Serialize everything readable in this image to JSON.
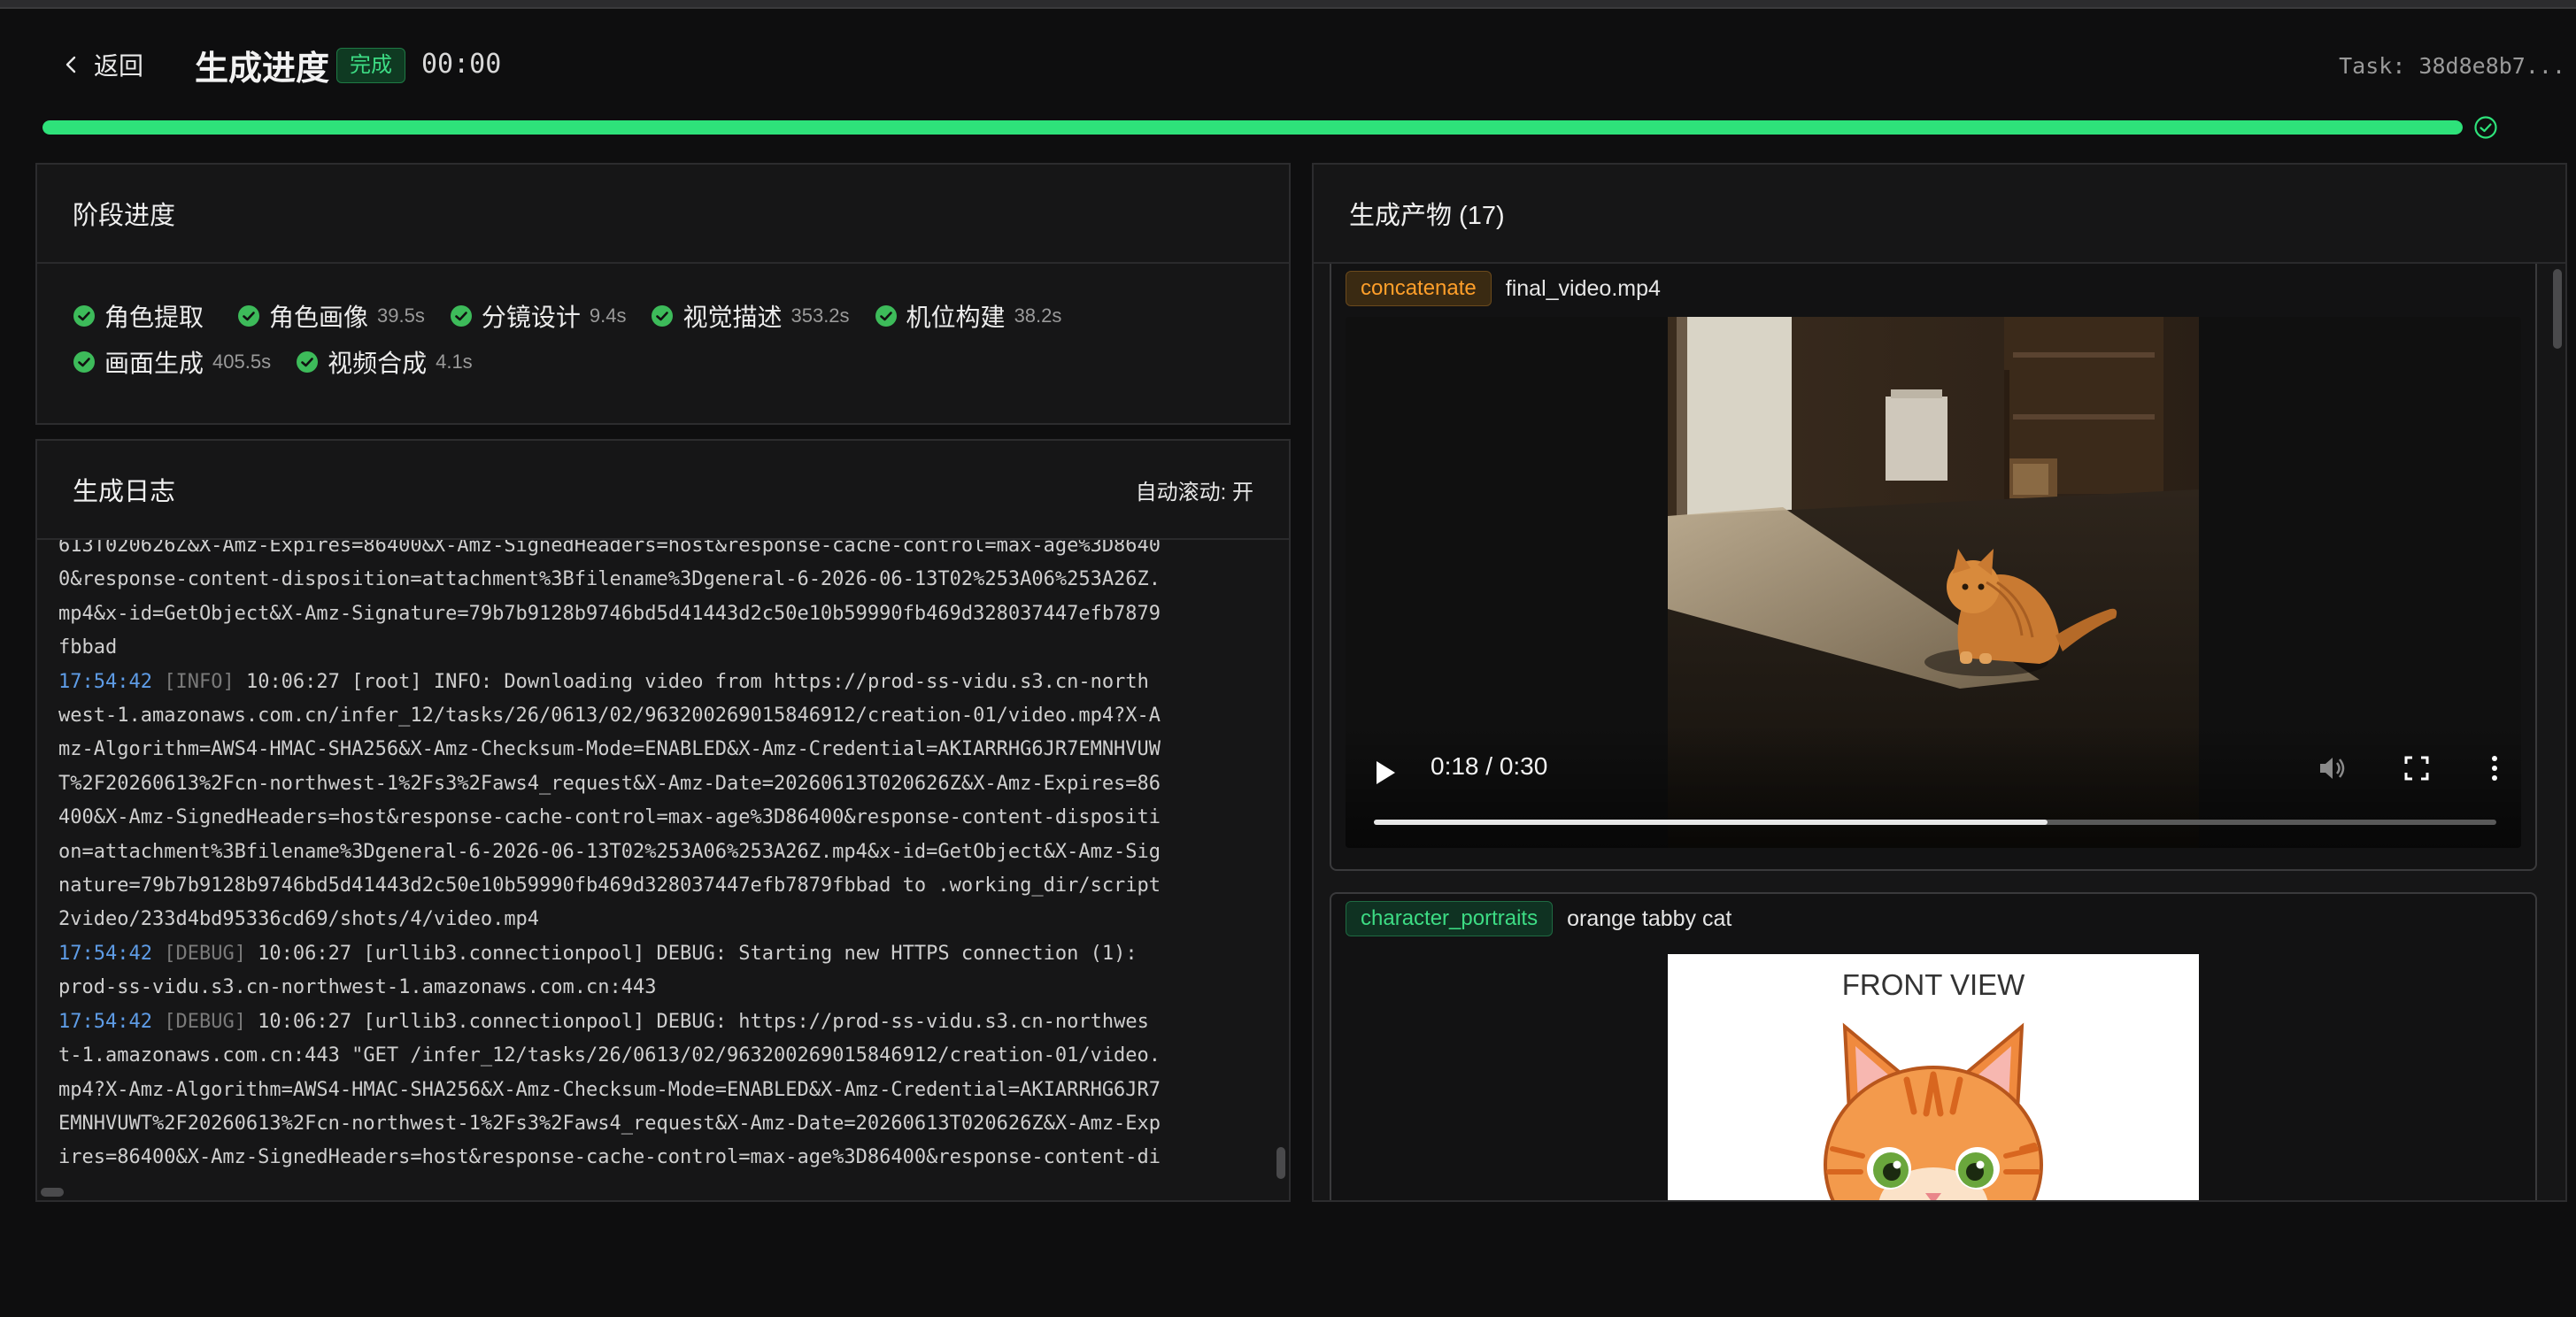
{
  "header": {
    "back_label": "返回",
    "title": "生成进度",
    "status": "完成",
    "timer": "00:00",
    "task": "Task: 38d8e8b7..."
  },
  "progress": {
    "percent": 100,
    "color": "#2ee27a"
  },
  "stages_panel": {
    "title": "阶段进度",
    "stages": [
      {
        "name": "角色提取",
        "duration": ""
      },
      {
        "name": "角色画像",
        "duration": "39.5s"
      },
      {
        "name": "分镜设计",
        "duration": "9.4s"
      },
      {
        "name": "视觉描述",
        "duration": "353.2s"
      },
      {
        "name": "机位构建",
        "duration": "38.2s"
      },
      {
        "name": "画面生成",
        "duration": "405.5s"
      },
      {
        "name": "视频合成",
        "duration": "4.1s"
      }
    ]
  },
  "log_panel": {
    "title": "生成日志",
    "auto_scroll": "自动滚动: 开",
    "lines": [
      {
        "ts": "",
        "level": "",
        "text": "613T020626Z&X-Amz-Expires=86400&X-Amz-SignedHeaders=host&response-cache-control=max-age%3D8640"
      },
      {
        "ts": "",
        "level": "",
        "text": "0&response-content-disposition=attachment%3Bfilename%3Dgeneral-6-2026-06-13T02%253A06%253A26Z."
      },
      {
        "ts": "",
        "level": "",
        "text": "mp4&x-id=GetObject&X-Amz-Signature=79b7b9128b9746bd5d41443d2c50e10b59990fb469d328037447efb7879"
      },
      {
        "ts": "",
        "level": "",
        "text": "fbbad"
      },
      {
        "ts": "17:54:42",
        "level": "[INFO]",
        "text": " 10:06:27 [root] INFO: Downloading video from https://prod-ss-vidu.s3.cn-north"
      },
      {
        "ts": "",
        "level": "",
        "text": "west-1.amazonaws.com.cn/infer_12/tasks/26/0613/02/963200269015846912/creation-01/video.mp4?X-A"
      },
      {
        "ts": "",
        "level": "",
        "text": "mz-Algorithm=AWS4-HMAC-SHA256&X-Amz-Checksum-Mode=ENABLED&X-Amz-Credential=AKIARRHG6JR7EMNHVUW"
      },
      {
        "ts": "",
        "level": "",
        "text": "T%2F20260613%2Fcn-northwest-1%2Fs3%2Faws4_request&X-Amz-Date=20260613T020626Z&X-Amz-Expires=86"
      },
      {
        "ts": "",
        "level": "",
        "text": "400&X-Amz-SignedHeaders=host&response-cache-control=max-age%3D86400&response-content-dispositi"
      },
      {
        "ts": "",
        "level": "",
        "text": "on=attachment%3Bfilename%3Dgeneral-6-2026-06-13T02%253A06%253A26Z.mp4&x-id=GetObject&X-Amz-Sig"
      },
      {
        "ts": "",
        "level": "",
        "text": "nature=79b7b9128b9746bd5d41443d2c50e10b59990fb469d328037447efb7879fbbad to .working_dir/script"
      },
      {
        "ts": "",
        "level": "",
        "text": "2video/233d4bd95336cd69/shots/4/video.mp4"
      },
      {
        "ts": "17:54:42",
        "level": "[DEBUG]",
        "text": " 10:06:27 [urllib3.connectionpool] DEBUG: Starting new HTTPS connection (1):"
      },
      {
        "ts": "",
        "level": "",
        "text": "prod-ss-vidu.s3.cn-northwest-1.amazonaws.com.cn:443"
      },
      {
        "ts": "17:54:42",
        "level": "[DEBUG]",
        "text": " 10:06:27 [urllib3.connectionpool] DEBUG: https://prod-ss-vidu.s3.cn-northwes"
      },
      {
        "ts": "",
        "level": "",
        "text": "t-1.amazonaws.com.cn:443 \"GET /infer_12/tasks/26/0613/02/963200269015846912/creation-01/video."
      },
      {
        "ts": "",
        "level": "",
        "text": "mp4?X-Amz-Algorithm=AWS4-HMAC-SHA256&X-Amz-Checksum-Mode=ENABLED&X-Amz-Credential=AKIARRHG6JR7"
      },
      {
        "ts": "",
        "level": "",
        "text": "EMNHVUWT%2F20260613%2Fcn-northwest-1%2Fs3%2Faws4_request&X-Amz-Date=20260613T020626Z&X-Amz-Exp"
      },
      {
        "ts": "",
        "level": "",
        "text": "ires=86400&X-Amz-SignedHeaders=host&response-cache-control=max-age%3D86400&response-content-di"
      }
    ]
  },
  "artifacts_panel": {
    "title": "生成产物 (17)",
    "items": [
      {
        "tag": "concatenate",
        "tag_color": "#ff9f2a",
        "name": "final_video.mp4",
        "type": "video",
        "time": "0:18 / 0:30",
        "played_fraction": 0.6
      },
      {
        "tag": "character_portraits",
        "tag_color": "#3ddc84",
        "name": "orange tabby cat",
        "type": "image",
        "caption": "FRONT VIEW"
      }
    ]
  }
}
